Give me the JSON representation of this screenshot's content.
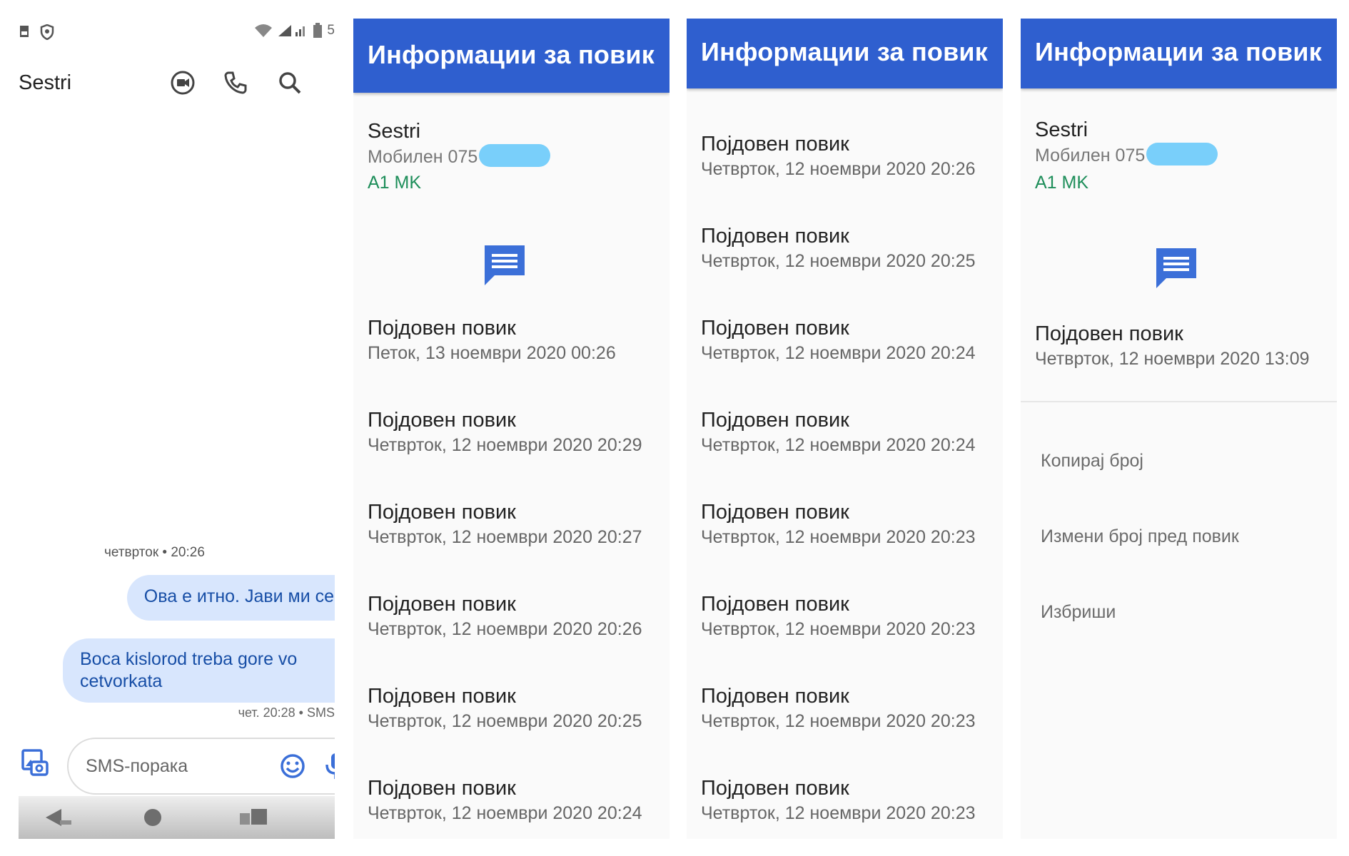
{
  "messages_screen": {
    "status_battery": "5",
    "header_title": "Sestri",
    "date_separator": "четврток • 20:26",
    "bubbles": [
      {
        "text": "Ова е итно. Јави ми се."
      },
      {
        "text": "Boca kislorod treba gore vo cetvorkata"
      }
    ],
    "bubble_meta": "чет. 20:28 • SMS",
    "compose_placeholder": "SMS-порака"
  },
  "call_info_1": {
    "title": "Информации за повик",
    "contact_name": "Sestri",
    "contact_number": "Мобилен 075",
    "carrier": "A1 MK",
    "calls": [
      {
        "type": "Појдовен повик",
        "date": "Петок, 13 ноември 2020 00:26"
      },
      {
        "type": "Појдовен повик",
        "date": "Четврток, 12 ноември 2020 20:29"
      },
      {
        "type": "Појдовен повик",
        "date": "Четврток, 12 ноември 2020 20:27"
      },
      {
        "type": "Појдовен повик",
        "date": "Четврток, 12 ноември 2020 20:26"
      },
      {
        "type": "Појдовен повик",
        "date": "Четврток, 12 ноември 2020 20:25"
      },
      {
        "type": "Појдовен повик",
        "date": "Четврток, 12 ноември 2020 20:24"
      }
    ]
  },
  "call_info_2": {
    "title": "Информации за повик",
    "calls": [
      {
        "type": "Појдовен повик",
        "date": "Четврток, 12 ноември 2020 20:26"
      },
      {
        "type": "Појдовен повик",
        "date": "Четврток, 12 ноември 2020 20:25"
      },
      {
        "type": "Појдовен повик",
        "date": "Четврток, 12 ноември 2020 20:24"
      },
      {
        "type": "Појдовен повик",
        "date": "Четврток, 12 ноември 2020 20:24"
      },
      {
        "type": "Појдовен повик",
        "date": "Четврток, 12 ноември 2020 20:23"
      },
      {
        "type": "Појдовен повик",
        "date": "Четврток, 12 ноември 2020 20:23"
      },
      {
        "type": "Појдовен повик",
        "date": "Четврток, 12 ноември 2020 20:23"
      },
      {
        "type": "Појдовен повик",
        "date": "Четврток, 12 ноември 2020 20:23"
      }
    ]
  },
  "call_info_3": {
    "title": "Информации за повик",
    "contact_name": "Sestri",
    "contact_number": "Мобилен 075",
    "carrier": "A1 MK",
    "calls": [
      {
        "type": "Појдовен повик",
        "date": "Четврток, 12 ноември 2020 13:09"
      }
    ],
    "actions": [
      "Копирај број",
      "Измени број пред повик",
      "Избриши"
    ]
  },
  "colors": {
    "app_bar": "#2f5fcf",
    "bubble_bg": "#d8e6fd",
    "bubble_text": "#174ea6",
    "carrier_green": "#1e8e5a",
    "redaction": "#79cffa"
  },
  "icons": [
    "image-icon",
    "shield-icon",
    "wifi-icon",
    "signal-icon",
    "battery-icon",
    "video-call-icon",
    "phone-icon",
    "search-icon",
    "message-icon",
    "attach-image-icon",
    "emoji-icon",
    "mic-icon",
    "back-icon",
    "home-icon",
    "recents-icon"
  ]
}
